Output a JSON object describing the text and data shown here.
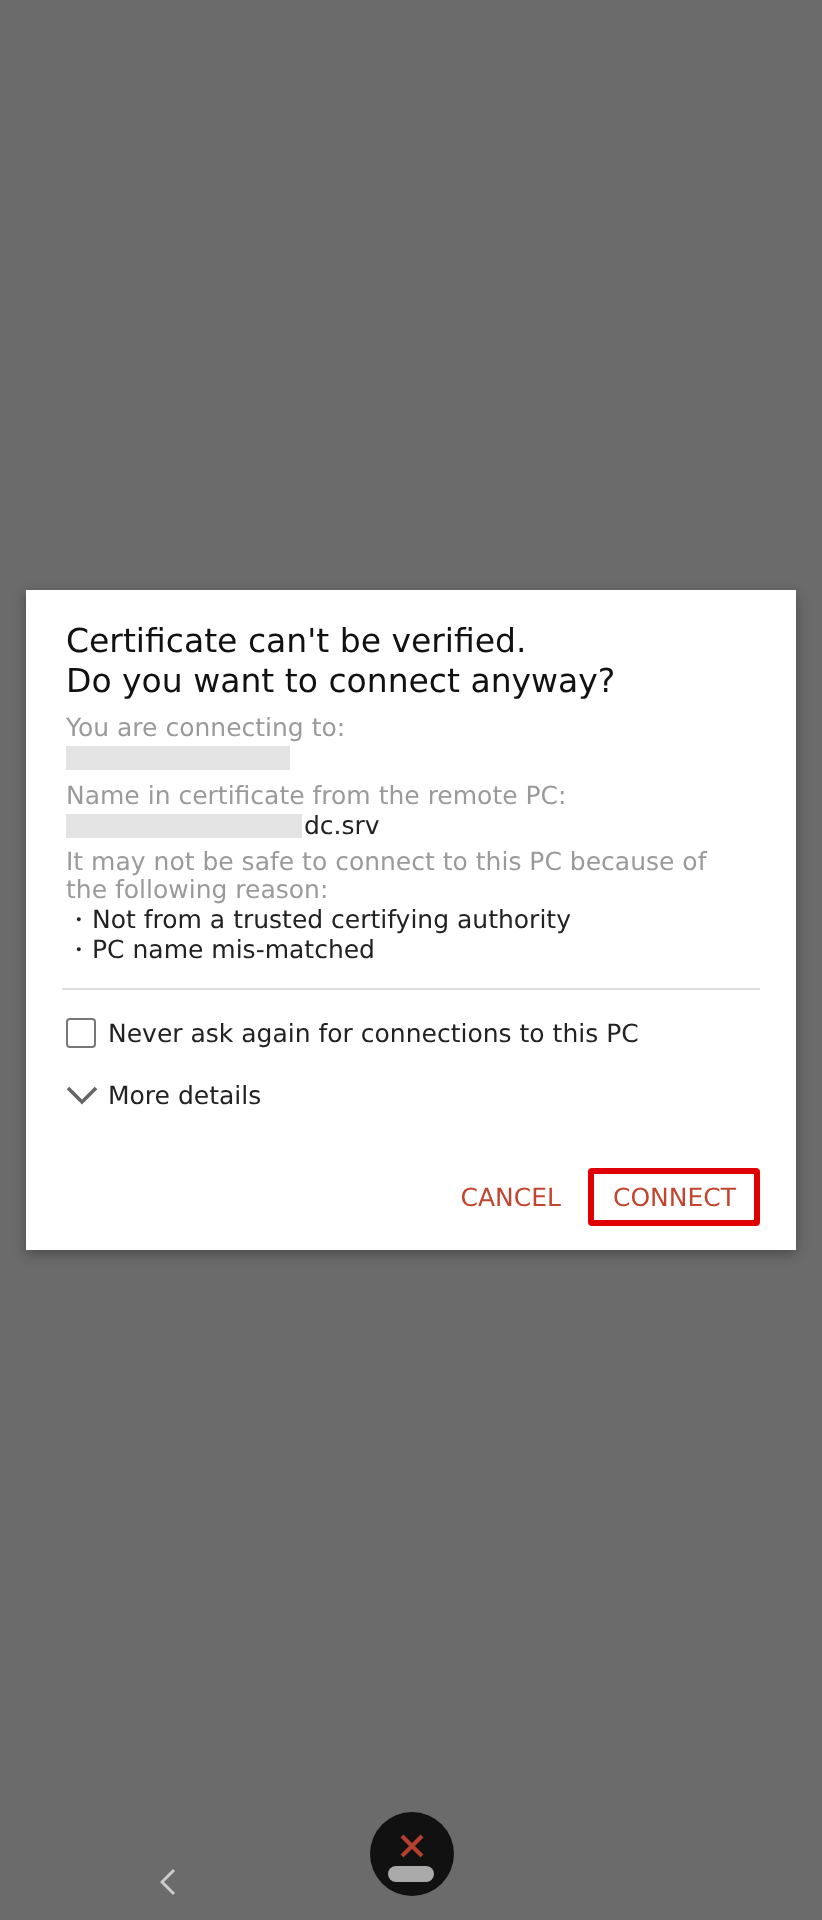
{
  "dialog": {
    "title_lines": [
      "Certificate can't be verified.",
      "Do you want to connect anyway?"
    ],
    "connecting_label": "You are connecting to:",
    "certificate_label": "Name in certificate from the remote PC:",
    "certificate_suffix": "dc.srv",
    "warning": "It may not be safe to connect to this PC because of the following reason:",
    "reasons": [
      "・Not from a trusted certifying authority",
      "・PC name mis-matched"
    ],
    "never_ask": {
      "label": "Never ask again for connections to this PC",
      "checked": false
    },
    "more_details": {
      "label": "More details",
      "expanded": false
    },
    "buttons": [
      {
        "label": "CANCEL",
        "highlighted": false
      },
      {
        "label": "CONNECT",
        "highlighted": true
      }
    ]
  }
}
